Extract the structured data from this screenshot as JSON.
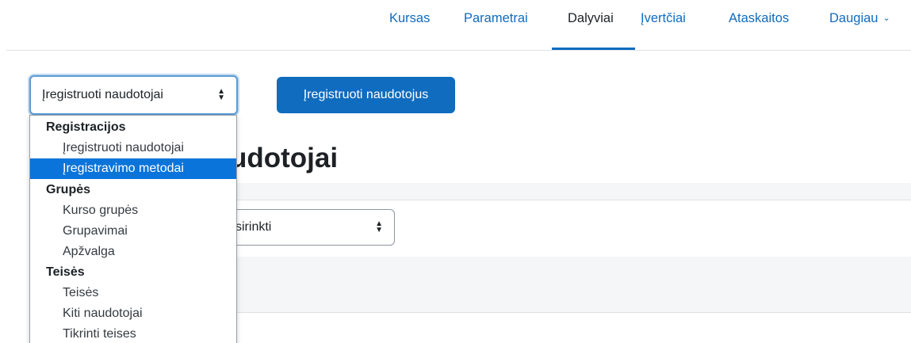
{
  "nav": {
    "items": [
      {
        "label": "Kursas"
      },
      {
        "label": "Parametrai"
      },
      {
        "label": "Dalyviai"
      },
      {
        "label": "Įvertčiai"
      },
      {
        "label": "Ataskaitos"
      },
      {
        "label": "Daugiau"
      }
    ],
    "active": "Dalyviai"
  },
  "page": {
    "enrol_select_value": "Įregistruoti naudotojai",
    "enrol_button_label": "Įregistruoti naudotojus",
    "heading_visible": "udotojai",
    "filter_select_value": "sirinkti"
  },
  "dropdown": {
    "groups": [
      {
        "label": "Registracijos",
        "options": [
          {
            "label": "Įregistruoti naudotojai",
            "selected": false
          },
          {
            "label": "Įregistravimo metodai",
            "selected": true
          }
        ]
      },
      {
        "label": "Grupės",
        "options": [
          {
            "label": "Kurso grupės",
            "selected": false
          },
          {
            "label": "Grupavimai",
            "selected": false
          },
          {
            "label": "Apžvalga",
            "selected": false
          }
        ]
      },
      {
        "label": "Teisės",
        "options": [
          {
            "label": "Teisės",
            "selected": false
          },
          {
            "label": "Kiti naudotojai",
            "selected": false
          },
          {
            "label": "Tikrinti teises",
            "selected": false
          }
        ]
      }
    ]
  },
  "colors": {
    "accent": "#0f6cbf",
    "highlight": "#0a74da"
  }
}
